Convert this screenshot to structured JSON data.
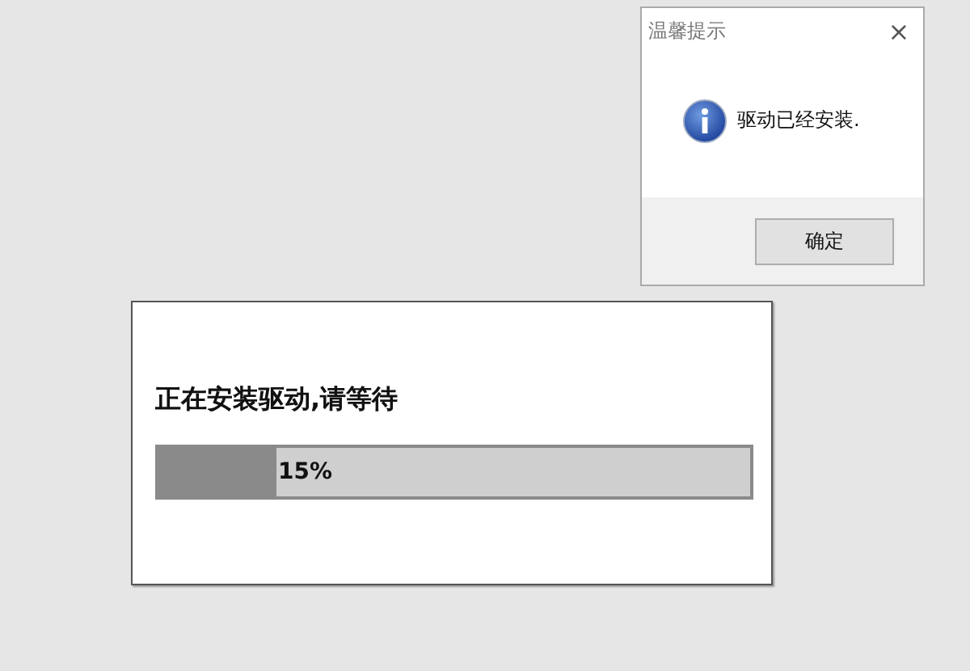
{
  "installer": {
    "message": "正在安装驱动,请等待",
    "progress": {
      "level": 0.2,
      "label": "15%"
    }
  },
  "dialog": {
    "title": "温馨提示",
    "close": "×",
    "message": "驱动已经安装.",
    "buttons": [
      "确定"
    ]
  }
}
